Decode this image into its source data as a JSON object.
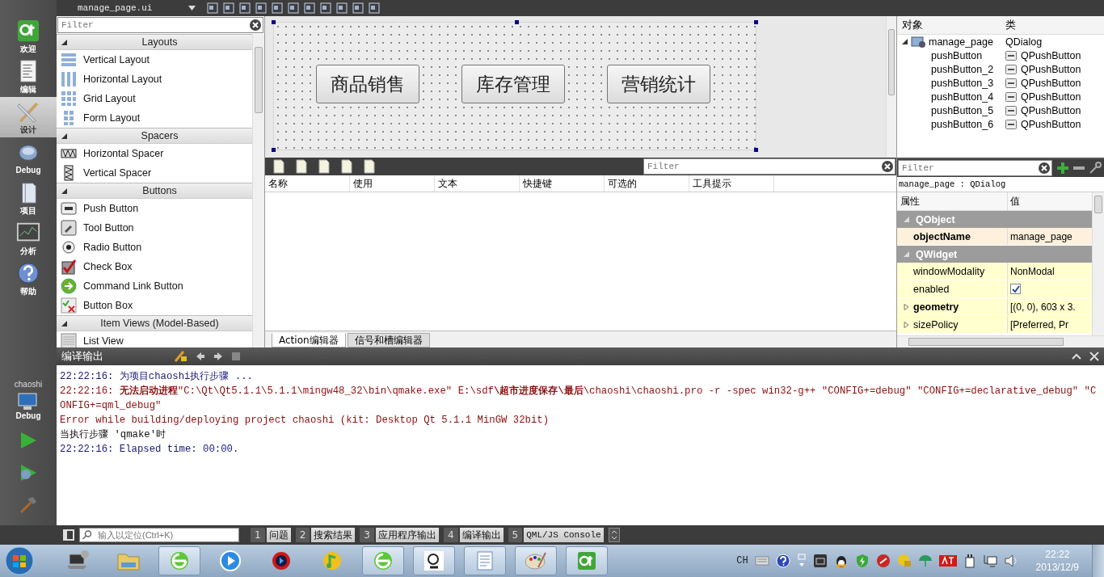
{
  "editor_tab": {
    "title": "manage_page.ui"
  },
  "mode_bar": {
    "items": [
      {
        "label": "欢迎",
        "kind": "welcome",
        "selected": false
      },
      {
        "label": "编辑",
        "kind": "edit",
        "selected": false
      },
      {
        "label": "设计",
        "kind": "design",
        "selected": true
      },
      {
        "label": "Debug",
        "kind": "debug",
        "selected": false
      },
      {
        "label": "项目",
        "kind": "projects",
        "selected": false
      },
      {
        "label": "分析",
        "kind": "analyze",
        "selected": false
      },
      {
        "label": "帮助",
        "kind": "help",
        "selected": false
      }
    ],
    "kit": {
      "project": "chaoshi",
      "build": "Debug"
    }
  },
  "widget_box": {
    "filter_placeholder": "Filter",
    "sections": [
      {
        "title": "Layouts",
        "items": [
          {
            "label": "Vertical Layout",
            "kind": "vlayout"
          },
          {
            "label": "Horizontal Layout",
            "kind": "hlayout"
          },
          {
            "label": "Grid Layout",
            "kind": "grid"
          },
          {
            "label": "Form Layout",
            "kind": "form"
          }
        ]
      },
      {
        "title": "Spacers",
        "items": [
          {
            "label": "Horizontal Spacer",
            "kind": "hspacer"
          },
          {
            "label": "Vertical Spacer",
            "kind": "vspacer"
          }
        ]
      },
      {
        "title": "Buttons",
        "items": [
          {
            "label": "Push Button",
            "kind": "push"
          },
          {
            "label": "Tool Button",
            "kind": "tool"
          },
          {
            "label": "Radio Button",
            "kind": "radio"
          },
          {
            "label": "Check Box",
            "kind": "check"
          },
          {
            "label": "Command Link Button",
            "kind": "command"
          },
          {
            "label": "Button Box",
            "kind": "buttonbox"
          }
        ]
      },
      {
        "title": "Item Views (Model-Based)",
        "items": [
          {
            "label": "List View",
            "kind": "list"
          }
        ]
      }
    ]
  },
  "form": {
    "buttons": [
      "商品销售",
      "库存管理",
      "营销统计"
    ]
  },
  "action_editor": {
    "filter_placeholder": "Filter",
    "columns": [
      "名称",
      "使用",
      "文本",
      "快捷键",
      "可选的",
      "工具提示"
    ],
    "tabs": [
      {
        "label": "Action编辑器",
        "selected": true
      },
      {
        "label": "信号和槽编辑器",
        "selected": false
      }
    ]
  },
  "object_inspector": {
    "columns": [
      "对象",
      "类"
    ],
    "root": {
      "name": "manage_page",
      "class": "QDialog",
      "expanded": true,
      "children": [
        {
          "name": "pushButton",
          "class": "QPushButton"
        },
        {
          "name": "pushButton_2",
          "class": "QPushButton"
        },
        {
          "name": "pushButton_3",
          "class": "QPushButton"
        },
        {
          "name": "pushButton_4",
          "class": "QPushButton"
        },
        {
          "name": "pushButton_5",
          "class": "QPushButton"
        },
        {
          "name": "pushButton_6",
          "class": "QPushButton"
        }
      ]
    }
  },
  "property_editor": {
    "filter_placeholder": "Filter",
    "context": "manage_page : QDialog",
    "columns": [
      "属性",
      "值"
    ],
    "groups": [
      {
        "name": "QObject",
        "expanded": true,
        "rows": [
          {
            "name": "objectName",
            "value": "manage_page",
            "kind": "text",
            "changed": true
          }
        ]
      },
      {
        "name": "QWidget",
        "expanded": true,
        "rows": [
          {
            "name": "windowModality",
            "value": "NonModal",
            "kind": "text",
            "changed": false
          },
          {
            "name": "enabled",
            "kind": "checkbox",
            "checked": true,
            "changed": false
          },
          {
            "name": "geometry",
            "value": "[(0, 0), 603 x 3.",
            "kind": "expandable",
            "changed": true
          },
          {
            "name": "sizePolicy",
            "value": "[Preferred, Pr",
            "kind": "expandable",
            "changed": false
          }
        ]
      }
    ]
  },
  "output": {
    "title": "编译输出",
    "lines": [
      {
        "kind": "info",
        "text": "22:22:16: 为项目chaoshi执行步骤 ..."
      },
      {
        "kind": "error",
        "text": "22:22:16: **无法启动进程**\"C:\\Qt\\Qt5.1.1\\5.1.1\\mingw48_32\\bin\\qmake.exe\" E:\\sdf**\\超市进度保存\\最后**\\chaoshi\\chaoshi.pro -r -spec win32-g++ \"CONFIG+=debug\" \"CONFIG+=declarative_debug\" \"CONFIG+=qml_debug\""
      },
      {
        "kind": "error",
        "text": "Error while building/deploying project chaoshi (kit: Desktop Qt 5.1.1 MinGW 32bit)"
      },
      {
        "kind": "plain",
        "text": "当执行步骤 'qmake'时"
      },
      {
        "kind": "info",
        "text": "22:22:16: Elapsed time: 00:00."
      }
    ]
  },
  "status_bar": {
    "locator_placeholder": "输入以定位(Ctrl+K)",
    "panes": [
      {
        "number": "1",
        "label": "问题"
      },
      {
        "number": "2",
        "label": "搜索结果"
      },
      {
        "number": "3",
        "label": "应用程序输出"
      },
      {
        "number": "4",
        "label": "编译输出"
      },
      {
        "number": "5",
        "label": "QML/JS Console"
      }
    ]
  },
  "taskbar": {
    "language": "CH",
    "time": "22:22",
    "date": "2013/12/9"
  }
}
